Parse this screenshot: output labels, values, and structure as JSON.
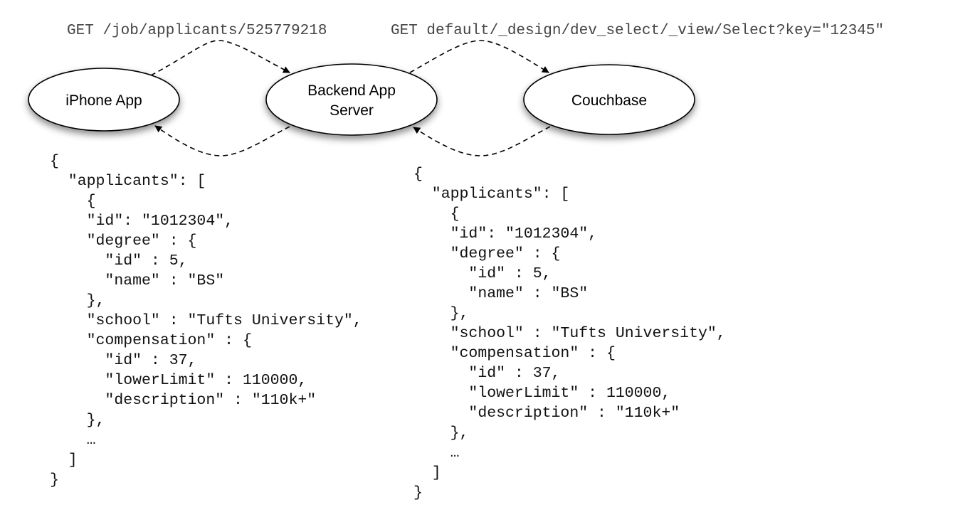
{
  "requests": {
    "client_to_server": "GET /job/applicants/525779218",
    "server_to_db": "GET default/_design/dev_select/_view/Select?key=\"12345\""
  },
  "nodes": {
    "client": {
      "label": "iPhone App"
    },
    "server": {
      "line1": "Backend App",
      "line2": "Server"
    },
    "database": {
      "label": "Couchbase"
    }
  },
  "responses": {
    "server_to_client": [
      "{",
      "  \"applicants\": [",
      "    {",
      "    \"id\": \"1012304\",",
      "    \"degree\" : {",
      "      \"id\" : 5,",
      "      \"name\" : \"BS\"",
      "    },",
      "    \"school\" : \"Tufts University\",",
      "    \"compensation\" : {",
      "      \"id\" : 37,",
      "      \"lowerLimit\" : 110000,",
      "      \"description\" : \"110k+\"",
      "    },",
      "    …",
      "  ]",
      "}"
    ],
    "db_to_server": [
      "{",
      "  \"applicants\": [",
      "    {",
      "    \"id\": \"1012304\",",
      "    \"degree\" : {",
      "      \"id\" : 5,",
      "      \"name\" : \"BS\"",
      "    },",
      "    \"school\" : \"Tufts University\",",
      "    \"compensation\" : {",
      "      \"id\" : 37,",
      "      \"lowerLimit\" : 110000,",
      "      \"description\" : \"110k+\"",
      "    },",
      "    …",
      "  ]",
      "}"
    ]
  }
}
